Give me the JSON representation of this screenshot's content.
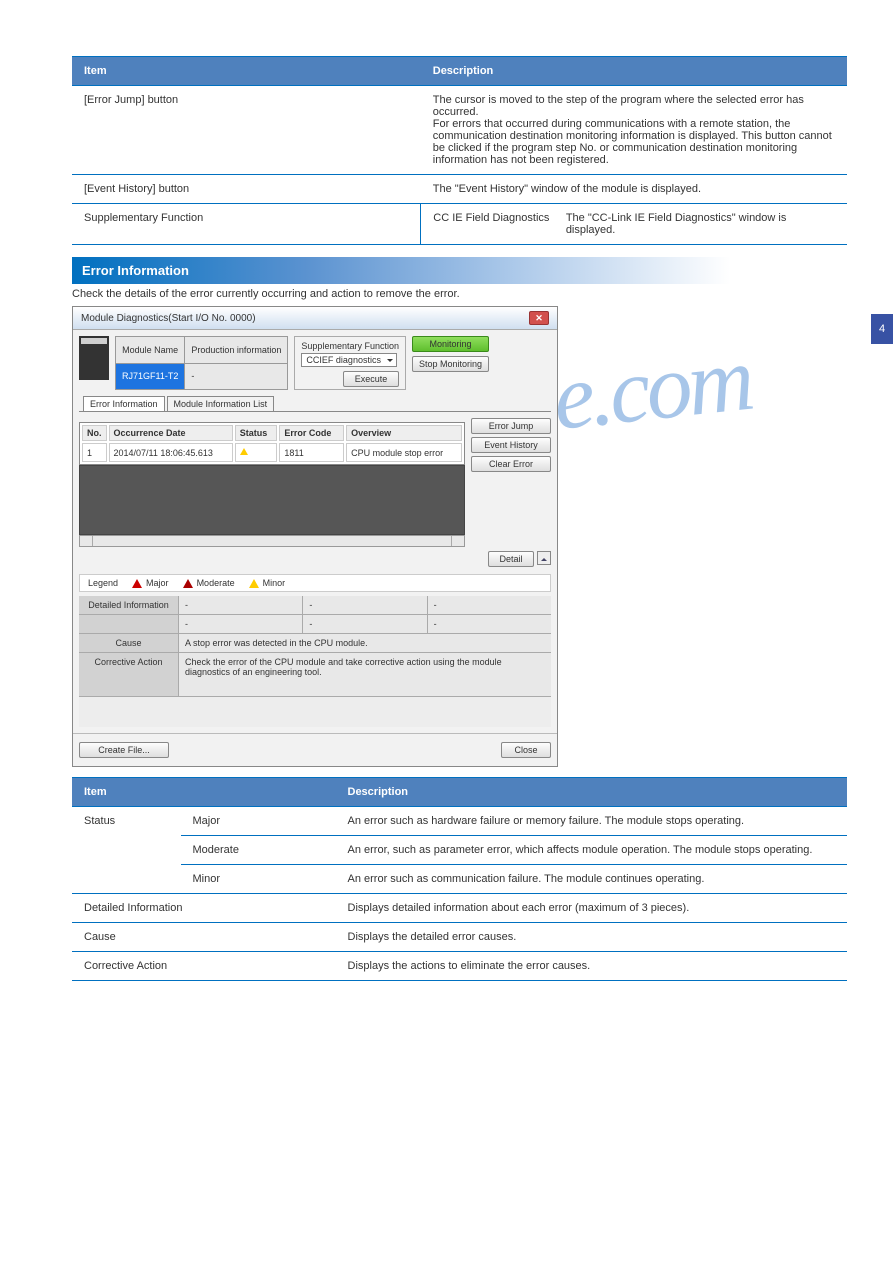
{
  "side_tab": "4",
  "table1": {
    "h1": "Item",
    "h2": "Description",
    "r1c1": "[Error Jump] button",
    "r1c2": "The cursor is moved to the step of the program where the selected error has occurred.\nFor errors that occurred during communications with a remote station, the communication destination monitoring information is displayed. This button cannot be clicked if the program step No. or communication destination monitoring information has not been registered.",
    "r2c1": "[Event History] button",
    "r2c2": "The \"Event History\" window of the module is displayed.",
    "r3c1a": "Supplementary Function",
    "r3c1b": "CC IE Field Diagnostics",
    "r3c2": "The \"CC-Link IE Field Diagnostics\" window is displayed."
  },
  "section_hdr": "Error Information",
  "intro": "Check the details of the error currently occurring and action to remove the error.",
  "dialog": {
    "title": "Module Diagnostics(Start I/O No. 0000)",
    "module_name_h": "Module Name",
    "prod_info_h": "Production information",
    "module_name_v": "RJ71GF11-T2",
    "prod_info_v": "-",
    "supp_label": "Supplementary Function",
    "supp_select": "CCIEF diagnostics",
    "btn_execute": "Execute",
    "btn_monitoring": "Monitoring",
    "btn_stop_mon": "Stop Monitoring",
    "tab_err": "Error Information",
    "tab_mod": "Module Information List",
    "col_no": "No.",
    "col_occ": "Occurrence Date",
    "col_status": "Status",
    "col_errcode": "Error Code",
    "col_overview": "Overview",
    "row_no": "1",
    "row_date": "2014/07/11 18:06:45.613",
    "row_code": "1811",
    "row_ov": "CPU module stop error",
    "btn_errjump": "Error Jump",
    "btn_evthist": "Event History",
    "btn_clrerr": "Clear Error",
    "btn_detail": "Detail",
    "legend": "Legend",
    "leg_major": "Major",
    "leg_mod": "Moderate",
    "leg_minor": "Minor",
    "det_info": "Detailed Information",
    "cause": "Cause",
    "cause_v": "A stop error was detected in the CPU module.",
    "corr": "Corrective Action",
    "corr_v": "Check the error of the CPU module and take corrective action using the module diagnostics of an engineering tool.",
    "btn_create": "Create File...",
    "btn_close": "Close"
  },
  "table2": {
    "h1": "Item",
    "h2": "Description",
    "r1a": "Status",
    "r1b": "Major",
    "r1bv": "An error such as hardware failure or memory failure. The module stops operating.",
    "r2b": "Moderate",
    "r2bv": "An error, such as parameter error, which affects module operation. The module stops operating.",
    "r3b": "Minor",
    "r3bv": "An error such as communication failure. The module continues operating.",
    "r4a": "Detailed Information",
    "r4b": "Displays detailed information about each error (maximum of 3 pieces).",
    "r5a": "Cause",
    "r5b": "Displays the detailed error causes.",
    "r6a": "Corrective Action",
    "r6b": "Displays the actions to eliminate the error causes."
  }
}
